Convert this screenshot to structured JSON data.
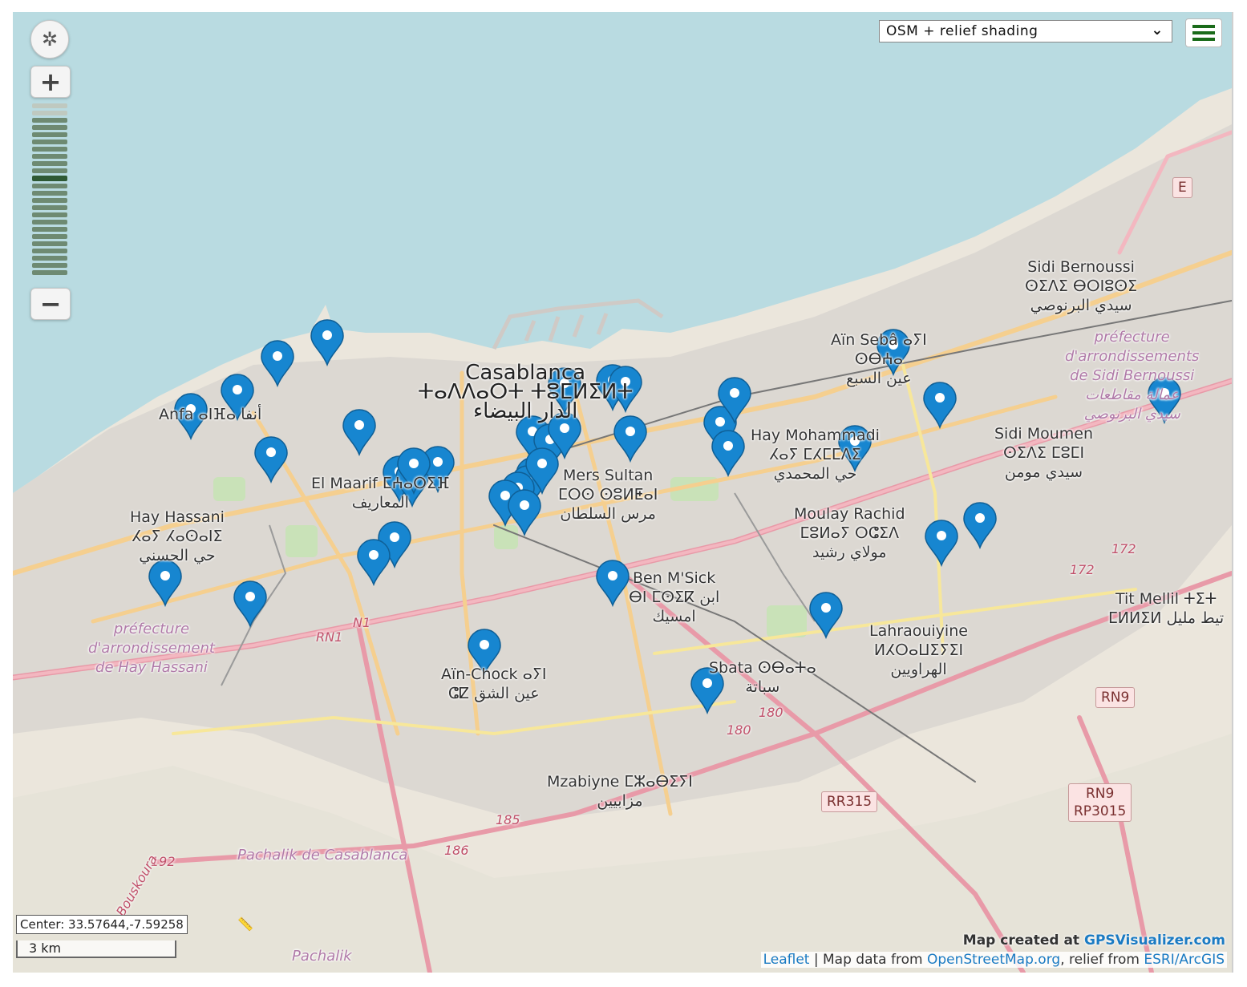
{
  "controls": {
    "recenter_glyph": "✲",
    "zoom_in_label": "+",
    "zoom_out_label": "−",
    "layer_select_value": "OSM + relief shading"
  },
  "place_labels": [
    {
      "id": "casablanca",
      "lines": [
        "Casablanca",
        "ⵜⴰⴷⴷⴰⵔⵜ ⵜⵓⵎⵍⵉⵍⵜ",
        "الدار البيضاء"
      ],
      "size": "big"
    },
    {
      "id": "sidi-bernoussi",
      "lines": [
        "Sidi Bernoussi",
        "ⵙⵉⴷⵉ ⴱⵔⵏⵓⵙⵉ",
        "سيدي البرنوصي"
      ]
    },
    {
      "id": "ain-sebaa",
      "lines": [
        "Aïn Sebâ ⴰⵢⵏ",
        "ⵙⴱⵄⴰ",
        "عين السبع"
      ]
    },
    {
      "id": "hay-mohammadi",
      "lines": [
        "Hay Mohammadi",
        "ⵃⴰⵢ ⵎⵃⵎⵎⴷⵉ",
        "حي المحمدي"
      ]
    },
    {
      "id": "sidi-moumen",
      "lines": [
        "Sidi Moumen",
        "ⵙⵉⴷⵉ ⵎⵓⵎⵏ",
        "سيدي مومن"
      ]
    },
    {
      "id": "moulay-rachid",
      "lines": [
        "Moulay Rachid",
        "ⵎⵓⵍⴰⵢ ⵔⵛⵉⴷ",
        "مولاي رشيد"
      ]
    },
    {
      "id": "mers-sultan",
      "lines": [
        "Mers Sultan",
        "ⵎⵔⵙ ⵙⵓⵍⵟⴰⵏ",
        "مرس السلطان"
      ]
    },
    {
      "id": "el-maarif",
      "lines": [
        "El Maarif ⵎⵄⴰⵔⵉⴼ",
        "المعاريف"
      ]
    },
    {
      "id": "anfa",
      "lines": [
        "Anfa ⴰⵏⴼⴰ أنفا"
      ]
    },
    {
      "id": "hay-hassani",
      "lines": [
        "Hay Hassani",
        "ⵃⴰⵢ ⵃⴰⵙⴰⵏⵉ",
        "حي الحسني"
      ]
    },
    {
      "id": "ben-msick",
      "lines": [
        "Ben M'Sick",
        "ⴱⵏ ⵎⵙⵉⴽ ابن",
        "امسيك"
      ]
    },
    {
      "id": "ain-chock",
      "lines": [
        "Aïn-Chock ⴰⵢⵏ",
        "ⵛⵇ عين الشق"
      ]
    },
    {
      "id": "sbata",
      "lines": [
        "Sbata ⵙⴱⴰⵜⴰ",
        "سباتة"
      ]
    },
    {
      "id": "lahraouiyine",
      "lines": [
        "Lahraouiyine",
        "ⵍⵃⵔⴰⵡⵉⵢⵉⵏ",
        "الهراويين"
      ]
    },
    {
      "id": "tit-mellil",
      "lines": [
        "Tit Mellil ⵜⵉⵜ",
        "ⵎⵍⵍⵉⵍ تيط مليل"
      ]
    },
    {
      "id": "mzabiyne",
      "lines": [
        "Mzabiyne ⵎⵣⴰⴱⵉⵢⵏ",
        "مزابيين"
      ]
    },
    {
      "id": "pref-sidi-bernoussi",
      "lines": [
        "préfecture",
        "d'arrondissements",
        "de Sidi Bernoussi",
        "عمالة مقاطعات",
        "سيدي البرنوصي"
      ],
      "style": "pref"
    },
    {
      "id": "pref-hay-hassani",
      "lines": [
        "préfecture",
        "d'arrondissement",
        "de Hay Hassani"
      ],
      "style": "pref"
    },
    {
      "id": "pachalik-casa",
      "lines": [
        "Pachalik de Casablanca"
      ],
      "style": "pref"
    },
    {
      "id": "pachalik",
      "lines": [
        "Pachalik"
      ],
      "style": "pref"
    }
  ],
  "road_shields": [
    {
      "id": "E",
      "text": "E"
    },
    {
      "id": "RN9",
      "text": "RN9"
    },
    {
      "id": "RR315",
      "text": "RR315"
    },
    {
      "id": "RN9-RP3015",
      "text": "RN9\nRP3015"
    }
  ],
  "road_numbers": [
    {
      "id": "n1",
      "text": "N1"
    },
    {
      "id": "rn1",
      "text": "RN1"
    },
    {
      "id": "r172a",
      "text": "172"
    },
    {
      "id": "r172b",
      "text": "172"
    },
    {
      "id": "r180a",
      "text": "180"
    },
    {
      "id": "r180b",
      "text": "180"
    },
    {
      "id": "r185",
      "text": "185"
    },
    {
      "id": "r186",
      "text": "186"
    },
    {
      "id": "r192",
      "text": "192"
    },
    {
      "id": "skoura",
      "text": "Bouskoura"
    }
  ],
  "markers_count": 40,
  "footer": {
    "center_text": "Center: 33.57644,-7.59258",
    "scale_text": "3 km",
    "credit_prefix": "Map created at ",
    "credit_link": "GPSVisualizer.com",
    "attrib_leaflet": "Leaflet",
    "attrib_mid": " | Map data from ",
    "attrib_osm": "OpenStreetMap.org",
    "attrib_relief": ", relief from ",
    "attrib_esri": "ESRI/ArcGIS"
  },
  "colors": {
    "water": "#b9dbe1",
    "land": "#ebe6dc",
    "urban": "#d9d6d1",
    "marker": "#1786d0",
    "green": "#c9e2b8"
  }
}
